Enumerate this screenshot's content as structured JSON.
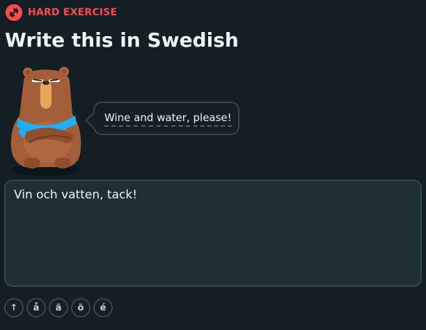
{
  "header": {
    "badge_icon": "dumbbell-icon",
    "badge_label": "HARD EXERCISE",
    "accent_color": "#ff4b4b"
  },
  "prompt": {
    "title": "Write this in Swedish",
    "character": "bear-character",
    "bubble_words": [
      "Wine",
      "and",
      "water,",
      "please!"
    ]
  },
  "answer": {
    "value": "Vin och vatten, tack!"
  },
  "special_keys": [
    "↑",
    "å",
    "ä",
    "ö",
    "é"
  ],
  "colors": {
    "background": "#131f24",
    "panel": "#202f36",
    "border": "#37464f",
    "text": "#f1f7fb"
  }
}
